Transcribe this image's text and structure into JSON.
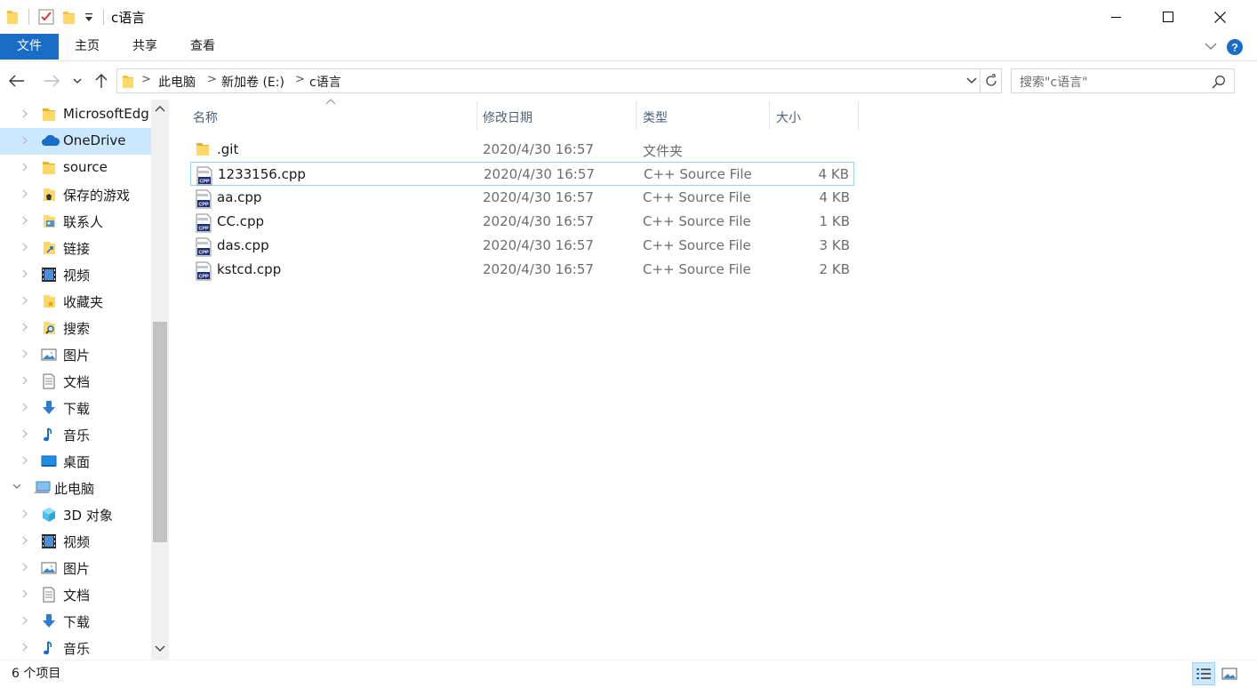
{
  "window": {
    "title": "c语言",
    "minimize_icon": "minimize-icon",
    "maximize_icon": "maximize-icon",
    "close_icon": "close-icon"
  },
  "ribbon": {
    "tabs": [
      {
        "label": "文件",
        "active": true
      },
      {
        "label": "主页"
      },
      {
        "label": "共享"
      },
      {
        "label": "查看"
      }
    ]
  },
  "address": {
    "breadcrumbs": [
      "此电脑",
      "新加卷 (E:)",
      "c语言"
    ],
    "separator": ">"
  },
  "search": {
    "placeholder": "搜索\"c语言\""
  },
  "nav": {
    "items": [
      {
        "label": "MicrosoftEdg",
        "icon": "folder-icon"
      },
      {
        "label": "OneDrive",
        "icon": "cloud-icon",
        "selected": true
      },
      {
        "label": "source",
        "icon": "folder-icon"
      },
      {
        "label": "保存的游戏",
        "icon": "saved-games-icon"
      },
      {
        "label": "联系人",
        "icon": "contacts-icon"
      },
      {
        "label": "链接",
        "icon": "links-icon"
      },
      {
        "label": "视频",
        "icon": "video-icon"
      },
      {
        "label": "收藏夹",
        "icon": "favorites-icon"
      },
      {
        "label": "搜索",
        "icon": "searches-icon"
      },
      {
        "label": "图片",
        "icon": "pictures-icon"
      },
      {
        "label": "文档",
        "icon": "documents-icon"
      },
      {
        "label": "下载",
        "icon": "download-icon"
      },
      {
        "label": "音乐",
        "icon": "music-icon"
      },
      {
        "label": "桌面",
        "icon": "desktop-icon"
      },
      {
        "label": "此电脑",
        "icon": "this-pc-icon",
        "expanded": true
      },
      {
        "label": "3D 对象",
        "icon": "3d-objects-icon"
      },
      {
        "label": "视频",
        "icon": "video-icon"
      },
      {
        "label": "图片",
        "icon": "pictures-icon"
      },
      {
        "label": "文档",
        "icon": "documents-icon"
      },
      {
        "label": "下载",
        "icon": "download-icon"
      },
      {
        "label": "音乐",
        "icon": "music-icon"
      }
    ]
  },
  "columns": {
    "name": "名称",
    "date": "修改日期",
    "type": "类型",
    "size": "大小"
  },
  "files": [
    {
      "name": ".git",
      "date": "2020/4/30 16:57",
      "type": "文件夹",
      "size": "",
      "icon": "folder-icon"
    },
    {
      "name": "1233156.cpp",
      "date": "2020/4/30 16:57",
      "type": "C++ Source File",
      "size": "4 KB",
      "icon": "cpp-file-icon",
      "selected": true
    },
    {
      "name": "aa.cpp",
      "date": "2020/4/30 16:57",
      "type": "C++ Source File",
      "size": "4 KB",
      "icon": "cpp-file-icon"
    },
    {
      "name": "CC.cpp",
      "date": "2020/4/30 16:57",
      "type": "C++ Source File",
      "size": "1 KB",
      "icon": "cpp-file-icon"
    },
    {
      "name": "das.cpp",
      "date": "2020/4/30 16:57",
      "type": "C++ Source File",
      "size": "3 KB",
      "icon": "cpp-file-icon"
    },
    {
      "name": "kstcd.cpp",
      "date": "2020/4/30 16:57",
      "type": "C++ Source File",
      "size": "2 KB",
      "icon": "cpp-file-icon"
    }
  ],
  "status": {
    "item_count": "6 个项目"
  },
  "colors": {
    "accent": "#1a6dc6",
    "selection": "#cce8ff",
    "selection_border": "#99d1ff",
    "folder": "#f5c342"
  }
}
